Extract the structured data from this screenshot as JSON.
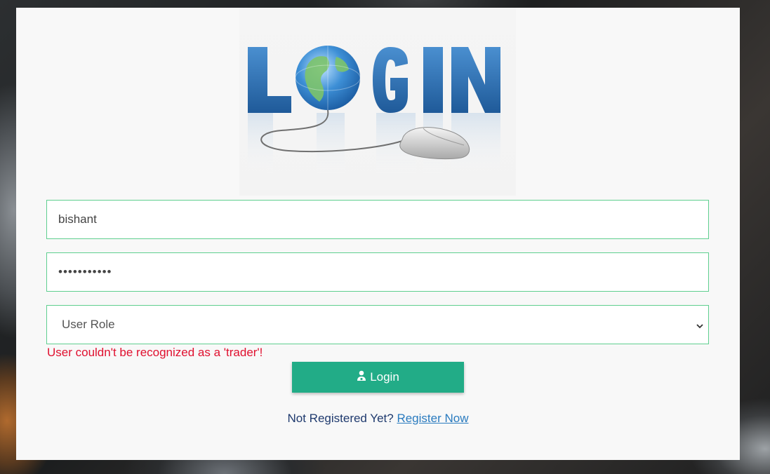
{
  "logo": {
    "text": "LOGIN"
  },
  "form": {
    "username_value": "bishant",
    "password_value": "•••••••••••",
    "role_selected": "User Role",
    "error_message": "User couldn't be recognized as a 'trader'!",
    "login_label": "Login",
    "login_icon": "user-doctor-icon",
    "register_prompt": "Not Registered Yet?",
    "register_link": "Register Now"
  },
  "colors": {
    "card_bg": "#f8f8f8",
    "input_border": "#5fcf8f",
    "button_bg": "#22ac87",
    "error_text": "#e0102f",
    "link": "#2a7bbf",
    "logo_blue": "#2f6fb3"
  }
}
